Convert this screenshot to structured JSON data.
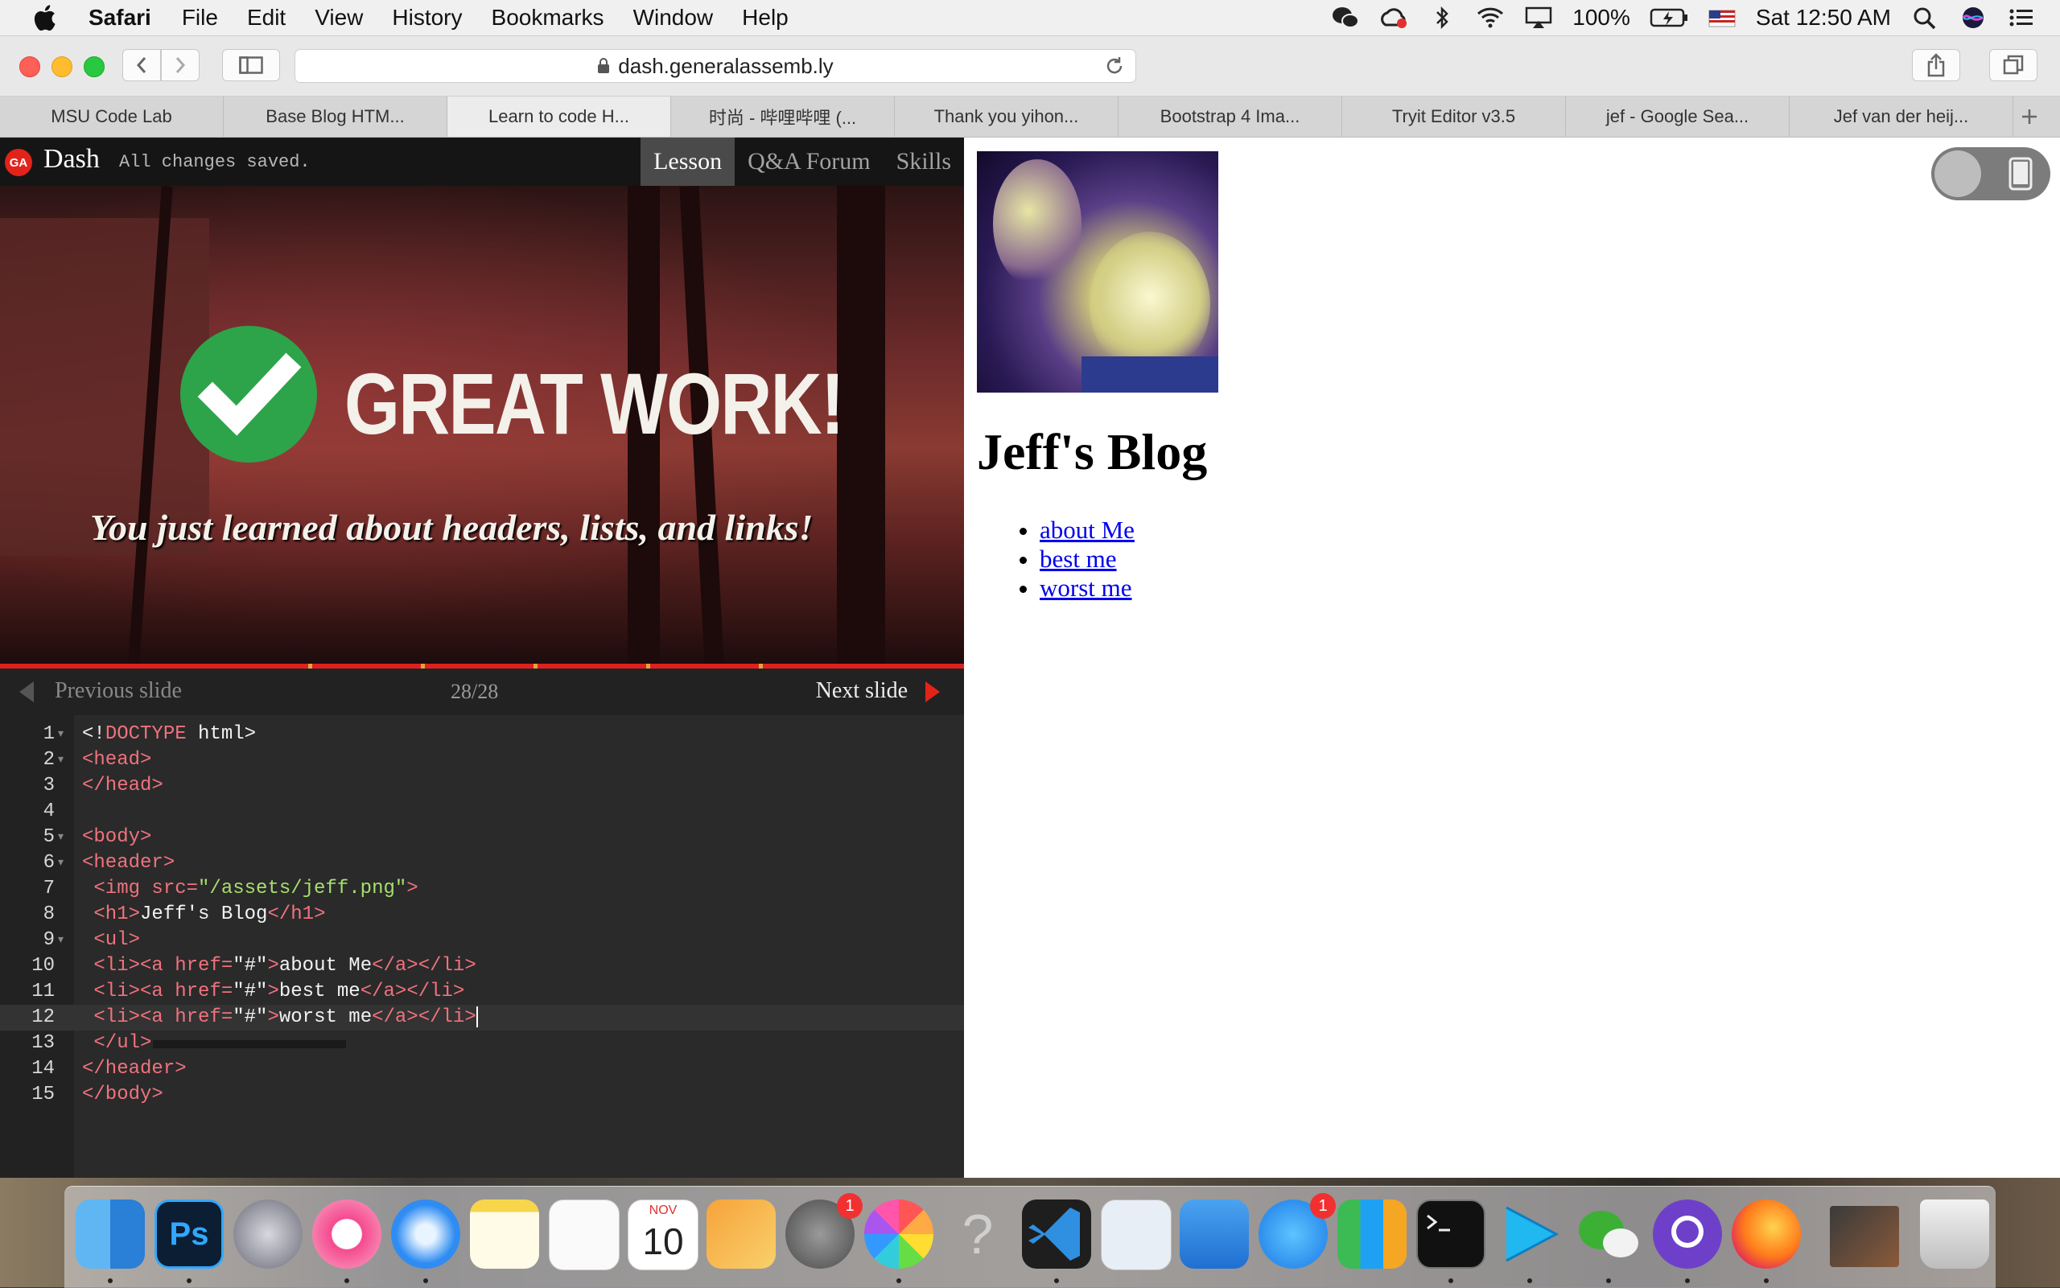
{
  "menubar": {
    "app_name": "Safari",
    "menus": [
      "File",
      "Edit",
      "View",
      "History",
      "Bookmarks",
      "Window",
      "Help"
    ],
    "battery": "100%",
    "clock": "Sat 12:50 AM"
  },
  "browser": {
    "url": "dash.generalassemb.ly",
    "tabs": [
      "MSU Code Lab",
      "Base Blog HTM...",
      "Learn to code H...",
      "时尚 - 哔哩哔哩 (...",
      "Thank you yihon...",
      "Bootstrap 4 Ima...",
      "Tryit Editor v3.5",
      "jef - Google Sea...",
      "Jef van der heij..."
    ],
    "active_tab": 2
  },
  "dash": {
    "logo": "GA",
    "title": "Dash",
    "status": "All changes saved.",
    "tabs": [
      "Lesson",
      "Q&A Forum",
      "Skills"
    ],
    "active_tab": 0,
    "slide": {
      "headline": "GREAT WORK!",
      "subtitle": "You just learned about headers, lists, and links!"
    },
    "nav": {
      "prev_label": "Previous slide",
      "counter": "28/28",
      "next_label": "Next slide"
    },
    "code": {
      "current_line": 12,
      "lines": [
        {
          "n": "1",
          "fold": true,
          "html": "&lt;!<span class='tg'>DOCTYPE</span> html&gt;"
        },
        {
          "n": "2",
          "fold": true,
          "html": "<span class='tg'>&lt;head&gt;</span>"
        },
        {
          "n": "3",
          "fold": false,
          "html": "<span class='tg'>&lt;/head&gt;</span>"
        },
        {
          "n": "4",
          "fold": false,
          "html": ""
        },
        {
          "n": "5",
          "fold": true,
          "html": "<span class='tg'>&lt;body&gt;</span>"
        },
        {
          "n": "6",
          "fold": true,
          "html": "<span class='tg'>&lt;header&gt;</span>"
        },
        {
          "n": "7",
          "fold": false,
          "html": " <span class='tg'>&lt;img </span><span class='at'>src=</span><span class='st'>\"/assets/jeff.png\"</span><span class='tg'>&gt;</span>"
        },
        {
          "n": "8",
          "fold": false,
          "html": " <span class='tg'>&lt;h1&gt;</span><span class='tx'>Jeff's Blog</span><span class='tg'>&lt;/h1&gt;</span>"
        },
        {
          "n": "9",
          "fold": true,
          "html": " <span class='tg'>&lt;ul&gt;</span>"
        },
        {
          "n": "10",
          "fold": false,
          "html": " <span class='tg'>&lt;li&gt;&lt;a </span><span class='at'>href=</span><span class='tx'>\"#\"</span><span class='tg'>&gt;</span><span class='tx'>about Me</span><span class='tg'>&lt;/a&gt;&lt;/li&gt;</span>"
        },
        {
          "n": "11",
          "fold": false,
          "html": " <span class='tg'>&lt;li&gt;&lt;a </span><span class='at'>href=</span><span class='tx'>\"#\"</span><span class='tg'>&gt;</span><span class='tx'>best me</span><span class='tg'>&lt;/a&gt;&lt;/li&gt;</span>"
        },
        {
          "n": "12",
          "fold": false,
          "html": " <span class='tg'>&lt;li&gt;&lt;a </span><span class='at'>href=</span><span class='tx'>\"#\"</span><span class='tg'>&gt;</span><span class='tx'>worst me</span><span class='tg'>&lt;/a&gt;&lt;/li&gt;</span><span class='caret'></span>"
        },
        {
          "n": "13",
          "fold": false,
          "html": " <span class='tg'>&lt;/ul&gt;</span>"
        },
        {
          "n": "14",
          "fold": false,
          "html": "<span class='tg'>&lt;/header&gt;</span>"
        },
        {
          "n": "15",
          "fold": false,
          "html": "<span class='tg'>&lt;/body&gt;</span>"
        }
      ]
    }
  },
  "preview": {
    "blog_title": "Jeff's Blog",
    "links": [
      "about Me",
      "best me",
      "worst me"
    ]
  },
  "dock": {
    "calendar_month": "NOV",
    "calendar_day": "10",
    "badges": {
      "system_preferences": "1",
      "app_store": "1"
    },
    "apps": [
      "finder",
      "photoshop",
      "launchpad",
      "itunes",
      "safari",
      "notes",
      "reminders",
      "calendar",
      "pages",
      "system-preferences",
      "photos",
      "help",
      "visual-studio-code",
      "preview",
      "keynote",
      "app-store",
      "numbers",
      "terminal",
      "infuse",
      "wechat",
      "github-desktop",
      "firefox",
      "photoshop-document",
      "trash"
    ]
  },
  "colors": {
    "ga_red": "#e2231a",
    "progress_bar": "#e02020",
    "check_green": "#2da44a",
    "link_blue": "#0000ee",
    "code_tag": "#f0727d",
    "code_string": "#a6df6f"
  }
}
